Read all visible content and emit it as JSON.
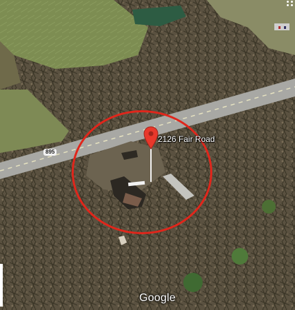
{
  "map": {
    "place_label": "2126 Fair Road",
    "route_shield": "895",
    "watermark": "Google",
    "icons": [
      "map-pin-icon",
      "more-dots-icon"
    ],
    "colors": {
      "pin": "#e8382b",
      "circle": "#e0261b",
      "road": "#a8a8a4"
    }
  }
}
